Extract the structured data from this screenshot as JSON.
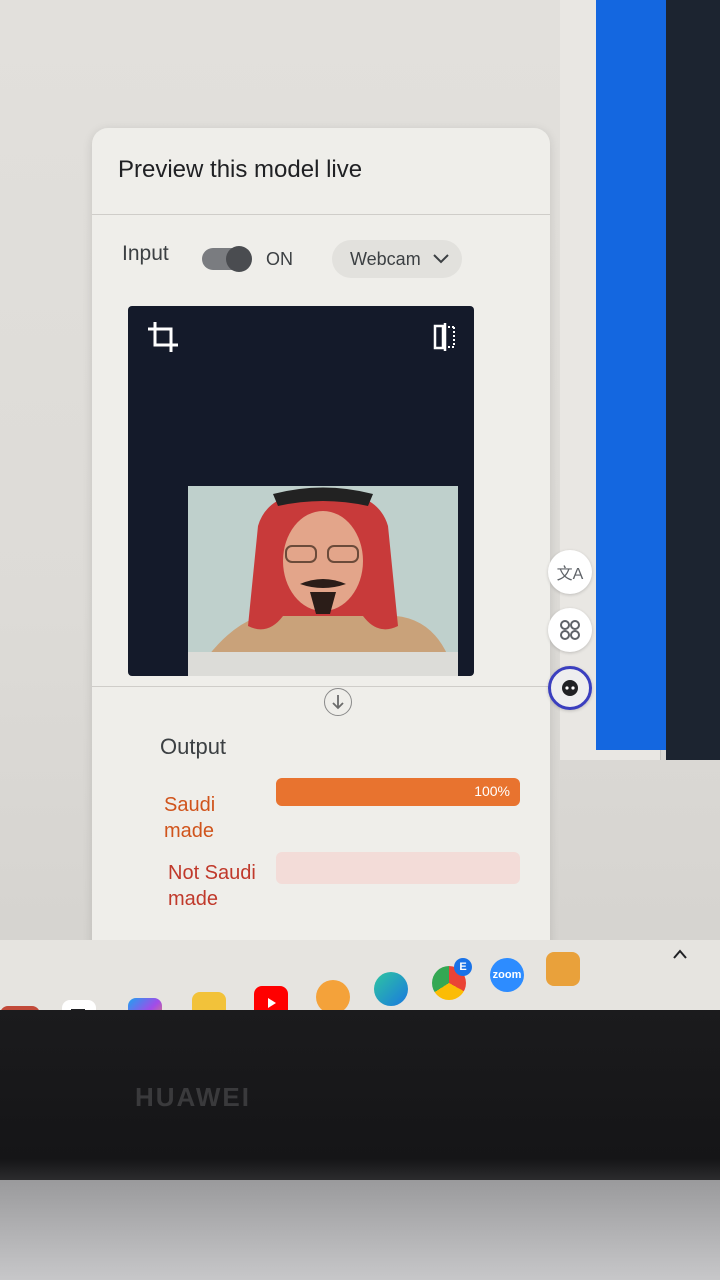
{
  "window": {
    "title": "Preview this model live",
    "input_label": "Input",
    "toggle_state": "ON",
    "source_selector": "Webcam",
    "output_label": "Output"
  },
  "classes": [
    {
      "name": "Saudi made",
      "confidence": 1.0,
      "percent_label": "100%",
      "color": "#e8732f"
    },
    {
      "name": "Not Saudi made",
      "confidence": 0.0,
      "percent_label": "",
      "color": "#c0392b"
    }
  ],
  "side_tools": [
    "translate-icon",
    "apps-icon",
    "assistant-icon"
  ],
  "taskbar": {
    "zoom_label": "zoom",
    "chrome_badge": "E"
  },
  "device": {
    "brand": "HUAWEI"
  }
}
